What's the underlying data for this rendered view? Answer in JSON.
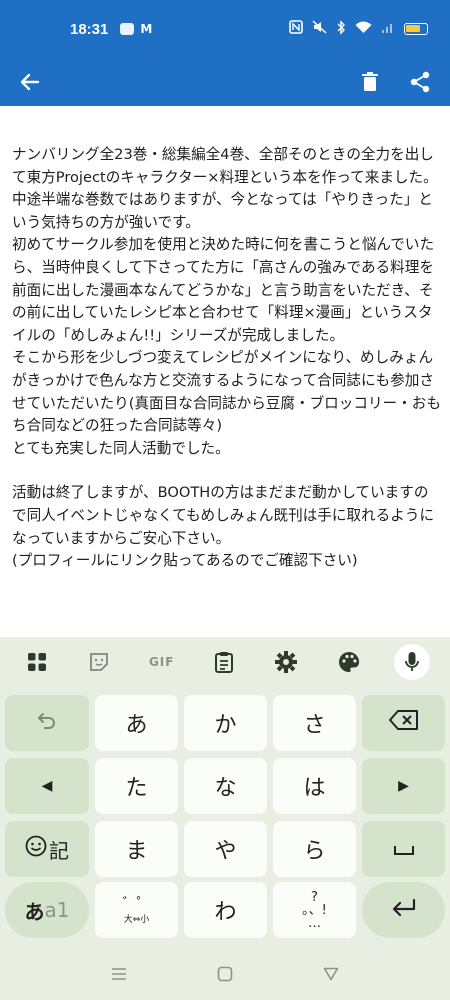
{
  "status_bar": {
    "time": "18:31",
    "app_icons": [
      "cloud-app-icon",
      "gmail-icon"
    ],
    "indicators": [
      "nfc-icon",
      "mute-icon",
      "bluetooth-icon",
      "wifi-icon",
      "signal-icon",
      "battery-icon"
    ]
  },
  "toolbar": {
    "back_icon": "arrow-left-icon",
    "actions": [
      "trash-icon",
      "share-icon"
    ],
    "color": "#1f6fc4"
  },
  "content": {
    "paragraphs": [
      "ナンバリング全23巻・総集編全4巻、全部そのときの全力を出して東方Projectのキャラクター×料理という本を作って来ました。\n中途半端な巻数ではありますが、今となっては「やりきった」という気持ちの方が強いです。\n初めてサークル参加を使用と決めた時に何を書こうと悩んでいたら、当時仲良くして下さってた方に「高さんの強みである料理を前面に出した漫画本なんてどうかな」と言う助言をいただき、その前に出していたレシピ本と合わせて「料理×漫画」というスタイルの「めしみょん!!」シリーズが完成しました。\nそこから形を少しづつ変えてレシピがメインになり、めしみょんがきっかけで色んな方と交流するようになって合同誌にも参加させていただいたり(真面目な合同誌から豆腐・ブロッコリー・おもち合同などの狂った合同誌等々)\nとても充実した同人活動でした。",
      "活動は終了しますが、BOOTHの方はまだまだ動かしていますので同人イベントじゃなくてもめしみょん既刊は手に取れるようになっていますからご安心下さい。\n(プロフィールにリンク貼ってあるのでご確認下さい)"
    ]
  },
  "keyboard": {
    "top_row": [
      "apps-grid-icon",
      "sticker-icon",
      "GIF",
      "clipboard-icon",
      "settings-gear-icon",
      "palette-icon",
      "microphone-icon"
    ],
    "keys": {
      "undo": "undo-icon",
      "a": "あ",
      "ka": "か",
      "sa": "さ",
      "backspace": "backspace-icon",
      "left": "◀",
      "ta": "た",
      "na": "な",
      "ha": "は",
      "right": "▶",
      "emoji_label": "記",
      "ma": "ま",
      "ya": "や",
      "ra": "ら",
      "space": "space-icon",
      "mode_a": "あ",
      "mode_1": "a1",
      "dakuten_top": "゛゜",
      "dakuten_bottom": "大⇔小",
      "wa": "わ",
      "punct_top": "?",
      "punct_bottom": "。、!",
      "punct_dots": "…",
      "enter": "enter-icon"
    },
    "accent": "#d6e3cc",
    "background": "#e8eee1"
  },
  "navbar": {
    "buttons": [
      "menu-icon",
      "home-icon",
      "back-triangle-icon"
    ]
  }
}
